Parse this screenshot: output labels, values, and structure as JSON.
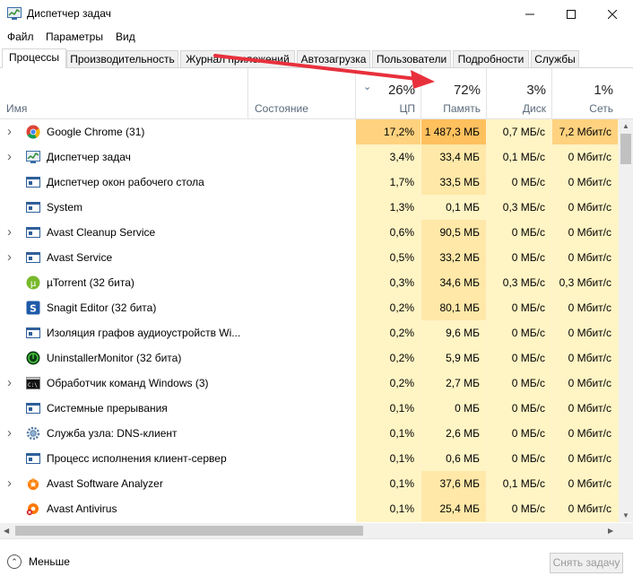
{
  "window": {
    "title": "Диспетчер задач",
    "minimize_icon": "minimize-icon",
    "maximize_icon": "maximize-icon",
    "close_icon": "close-icon"
  },
  "menu": [
    "Файл",
    "Параметры",
    "Вид"
  ],
  "tabs": [
    "Процессы",
    "Производительность",
    "Журнал приложений",
    "Автозагрузка",
    "Пользователи",
    "Подробности",
    "Службы"
  ],
  "active_tab": "Процессы",
  "columns": {
    "name": "Имя",
    "status": "Состояние",
    "cpu": {
      "pct": "26%",
      "label": "ЦП"
    },
    "memory": {
      "pct": "72%",
      "label": "Память"
    },
    "disk": {
      "pct": "3%",
      "label": "Диск"
    },
    "network": {
      "pct": "1%",
      "label": "Сеть"
    }
  },
  "processes": [
    {
      "name": "Google Chrome (31)",
      "expandable": true,
      "icon": "chrome-icon",
      "cpu": "17,2%",
      "memory": "1 487,3 МБ",
      "disk": "0,7 МБ/с",
      "network": "7,2 Мбит/с"
    },
    {
      "name": "Диспетчер задач",
      "expandable": true,
      "icon": "task-manager-icon",
      "cpu": "3,4%",
      "memory": "33,4 МБ",
      "disk": "0,1 МБ/с",
      "network": "0 Мбит/с"
    },
    {
      "name": "Диспетчер окон рабочего стола",
      "expandable": false,
      "icon": "window-app-icon",
      "cpu": "1,7%",
      "memory": "33,5 МБ",
      "disk": "0 МБ/с",
      "network": "0 Мбит/с"
    },
    {
      "name": "System",
      "expandable": false,
      "icon": "window-app-icon",
      "cpu": "1,3%",
      "memory": "0,1 МБ",
      "disk": "0,3 МБ/с",
      "network": "0 Мбит/с"
    },
    {
      "name": "Avast Cleanup Service",
      "expandable": true,
      "icon": "window-app-icon",
      "cpu": "0,6%",
      "memory": "90,5 МБ",
      "disk": "0 МБ/с",
      "network": "0 Мбит/с"
    },
    {
      "name": "Avast Service",
      "expandable": true,
      "icon": "window-app-icon",
      "cpu": "0,5%",
      "memory": "33,2 МБ",
      "disk": "0 МБ/с",
      "network": "0 Мбит/с"
    },
    {
      "name": "µTorrent (32 бита)",
      "expandable": false,
      "icon": "utorrent-icon",
      "cpu": "0,3%",
      "memory": "34,6 МБ",
      "disk": "0,3 МБ/с",
      "network": "0,3 Мбит/с"
    },
    {
      "name": "Snagit Editor (32 бита)",
      "expandable": false,
      "icon": "snagit-icon",
      "cpu": "0,2%",
      "memory": "80,1 МБ",
      "disk": "0 МБ/с",
      "network": "0 Мбит/с"
    },
    {
      "name": "Изоляция графов аудиоустройств Wi...",
      "expandable": false,
      "icon": "window-app-icon",
      "cpu": "0,2%",
      "memory": "9,6 МБ",
      "disk": "0 МБ/с",
      "network": "0 Мбит/с"
    },
    {
      "name": "UninstallerMonitor (32 бита)",
      "expandable": false,
      "icon": "uninstaller-icon",
      "cpu": "0,2%",
      "memory": "5,9 МБ",
      "disk": "0 МБ/с",
      "network": "0 Мбит/с"
    },
    {
      "name": "Обработчик команд Windows (3)",
      "expandable": true,
      "icon": "cmd-icon",
      "cpu": "0,2%",
      "memory": "2,7 МБ",
      "disk": "0 МБ/с",
      "network": "0 Мбит/с"
    },
    {
      "name": "Системные прерывания",
      "expandable": false,
      "icon": "window-app-icon",
      "cpu": "0,1%",
      "memory": "0 МБ",
      "disk": "0 МБ/с",
      "network": "0 Мбит/с"
    },
    {
      "name": "Служба узла: DNS-клиент",
      "expandable": true,
      "icon": "gear-icon",
      "cpu": "0,1%",
      "memory": "2,6 МБ",
      "disk": "0 МБ/с",
      "network": "0 Мбит/с"
    },
    {
      "name": "Процесс исполнения клиент-сервер",
      "expandable": false,
      "icon": "window-app-icon",
      "cpu": "0,1%",
      "memory": "0,6 МБ",
      "disk": "0 МБ/с",
      "network": "0 Мбит/с"
    },
    {
      "name": "Avast Software Analyzer",
      "expandable": true,
      "icon": "avast-icon",
      "cpu": "0,1%",
      "memory": "37,6 МБ",
      "disk": "0,1 МБ/с",
      "network": "0 Мбит/с"
    },
    {
      "name": "Avast Antivirus",
      "expandable": false,
      "icon": "avast-antivirus-icon",
      "cpu": "0,1%",
      "memory": "25,4 МБ",
      "disk": "0 МБ/с",
      "network": "0 Мбит/с"
    }
  ],
  "footer": {
    "less_label": "Меньше",
    "end_task_label": "Снять задачу"
  },
  "colors": {
    "heat_light": "#fff4c4",
    "heat_mid": "#ffe8a8",
    "heat_high": "#ffd27f",
    "heat_hot": "#ffc05e",
    "annotation_arrow": "#e8303c"
  }
}
